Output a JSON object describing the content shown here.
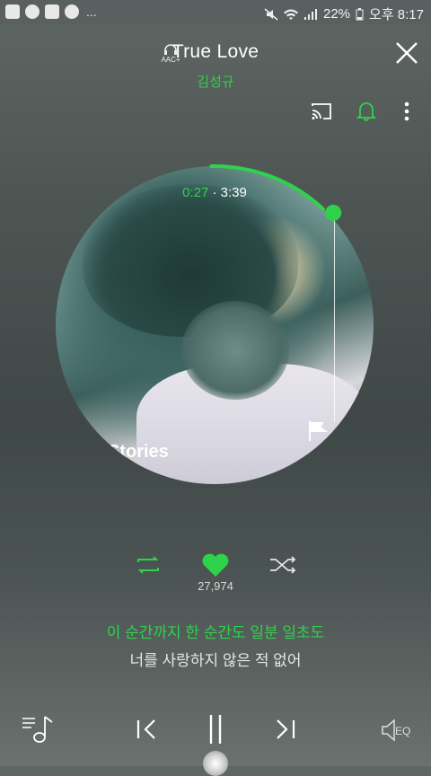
{
  "status_bar": {
    "left_dots": "...",
    "battery": "22%",
    "time": "오후 8:17"
  },
  "header": {
    "title": "True Love",
    "artist": "김성규",
    "quality_badge": "AAC+",
    "icons": [
      "cast-icon",
      "bell-icon",
      "more-vert-icon",
      "close-icon"
    ]
  },
  "album_art": {
    "overlay_text": "Stories"
  },
  "playback": {
    "current_time": "0:27",
    "separator": "·",
    "total_time": "3:39",
    "progress_fraction": 0.123
  },
  "controls": {
    "repeat_icon": "repeat-icon",
    "like_icon": "heart-icon",
    "like_count": "27,974",
    "shuffle_icon": "shuffle-icon"
  },
  "lyrics": {
    "current_line": "이 순간까지 한 순간도 일분 일초도",
    "next_line": "너를 사랑하지 않은 적 없어"
  },
  "bottom_bar": {
    "playlist_icon": "playlist-icon",
    "prev_icon": "previous-icon",
    "pause_icon": "pause-icon",
    "next_icon": "next-icon",
    "eq_label": "EQ"
  },
  "colors": {
    "accent": "#2ed34b"
  }
}
